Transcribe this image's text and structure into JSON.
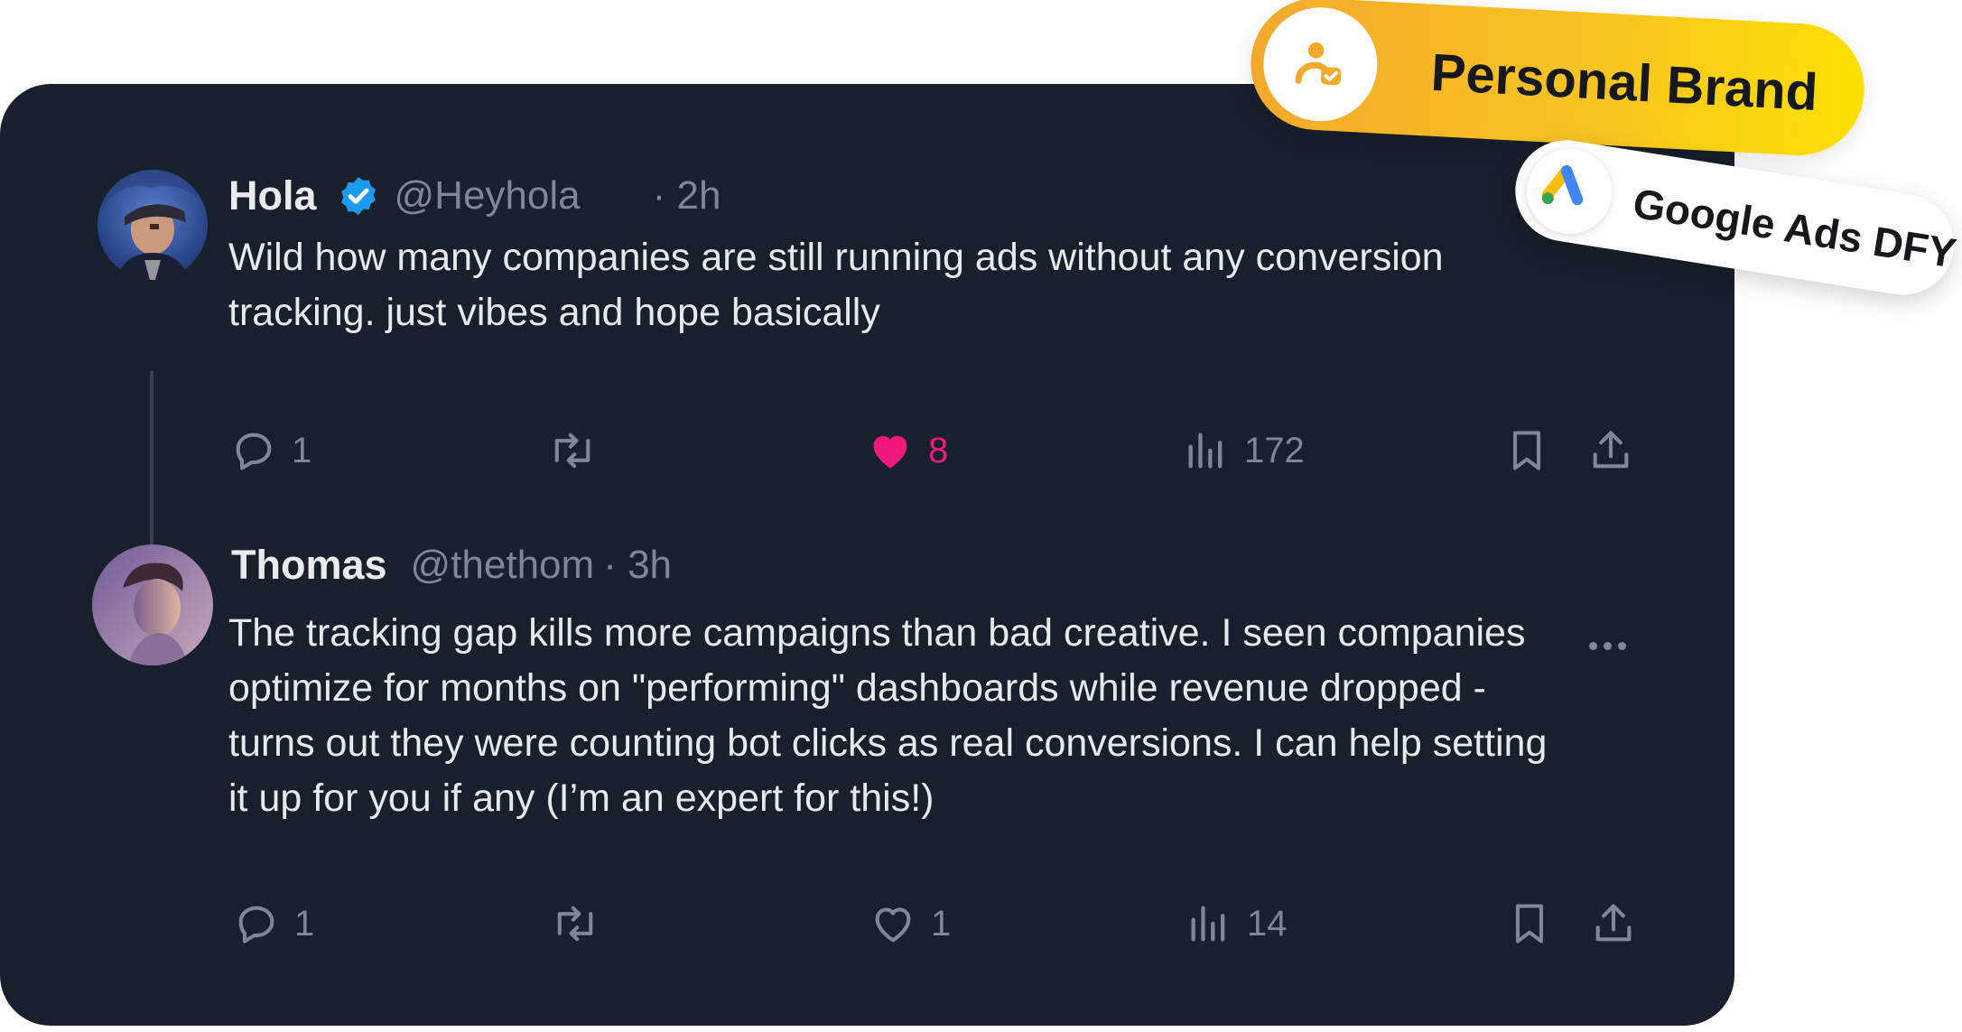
{
  "tweets": [
    {
      "name": "Hola",
      "verified": true,
      "handle": "@Heyhola",
      "time": "· 2h",
      "text": "Wild how many companies are still running ads without any conversion\ntracking. just vibes and hope basically",
      "actions": {
        "reply_count": "1",
        "retweet_count": "",
        "like_count": "8",
        "liked": true,
        "views_count": "172"
      }
    },
    {
      "name": "Thomas",
      "verified": false,
      "handle": "@thethom",
      "time": "· 3h",
      "text": "The tracking gap kills more campaigns than bad creative. I seen companies\noptimize for months on \"performing\" dashboards while revenue dropped -\nturns out they were counting bot clicks as real conversions. I can help setting\nit up for you if any (I’m an expert for this!)",
      "actions": {
        "reply_count": "1",
        "retweet_count": "",
        "like_count": "1",
        "liked": false,
        "views_count": "14"
      }
    }
  ],
  "badges": {
    "personal_brand": "Personal Brand",
    "google_ads": "Google Ads DFY"
  },
  "colors": {
    "card_bg": "#17202b",
    "verified_blue": "#1d9bf0",
    "like_pink": "#f0197d",
    "muted": "#7d8894",
    "badge_yellow": "#f8c61f"
  },
  "icons": [
    "reply-icon",
    "retweet-icon",
    "like-icon",
    "views-icon",
    "bookmark-icon",
    "share-icon",
    "more-icon",
    "verified-icon",
    "person-check-icon",
    "google-ads-icon"
  ]
}
